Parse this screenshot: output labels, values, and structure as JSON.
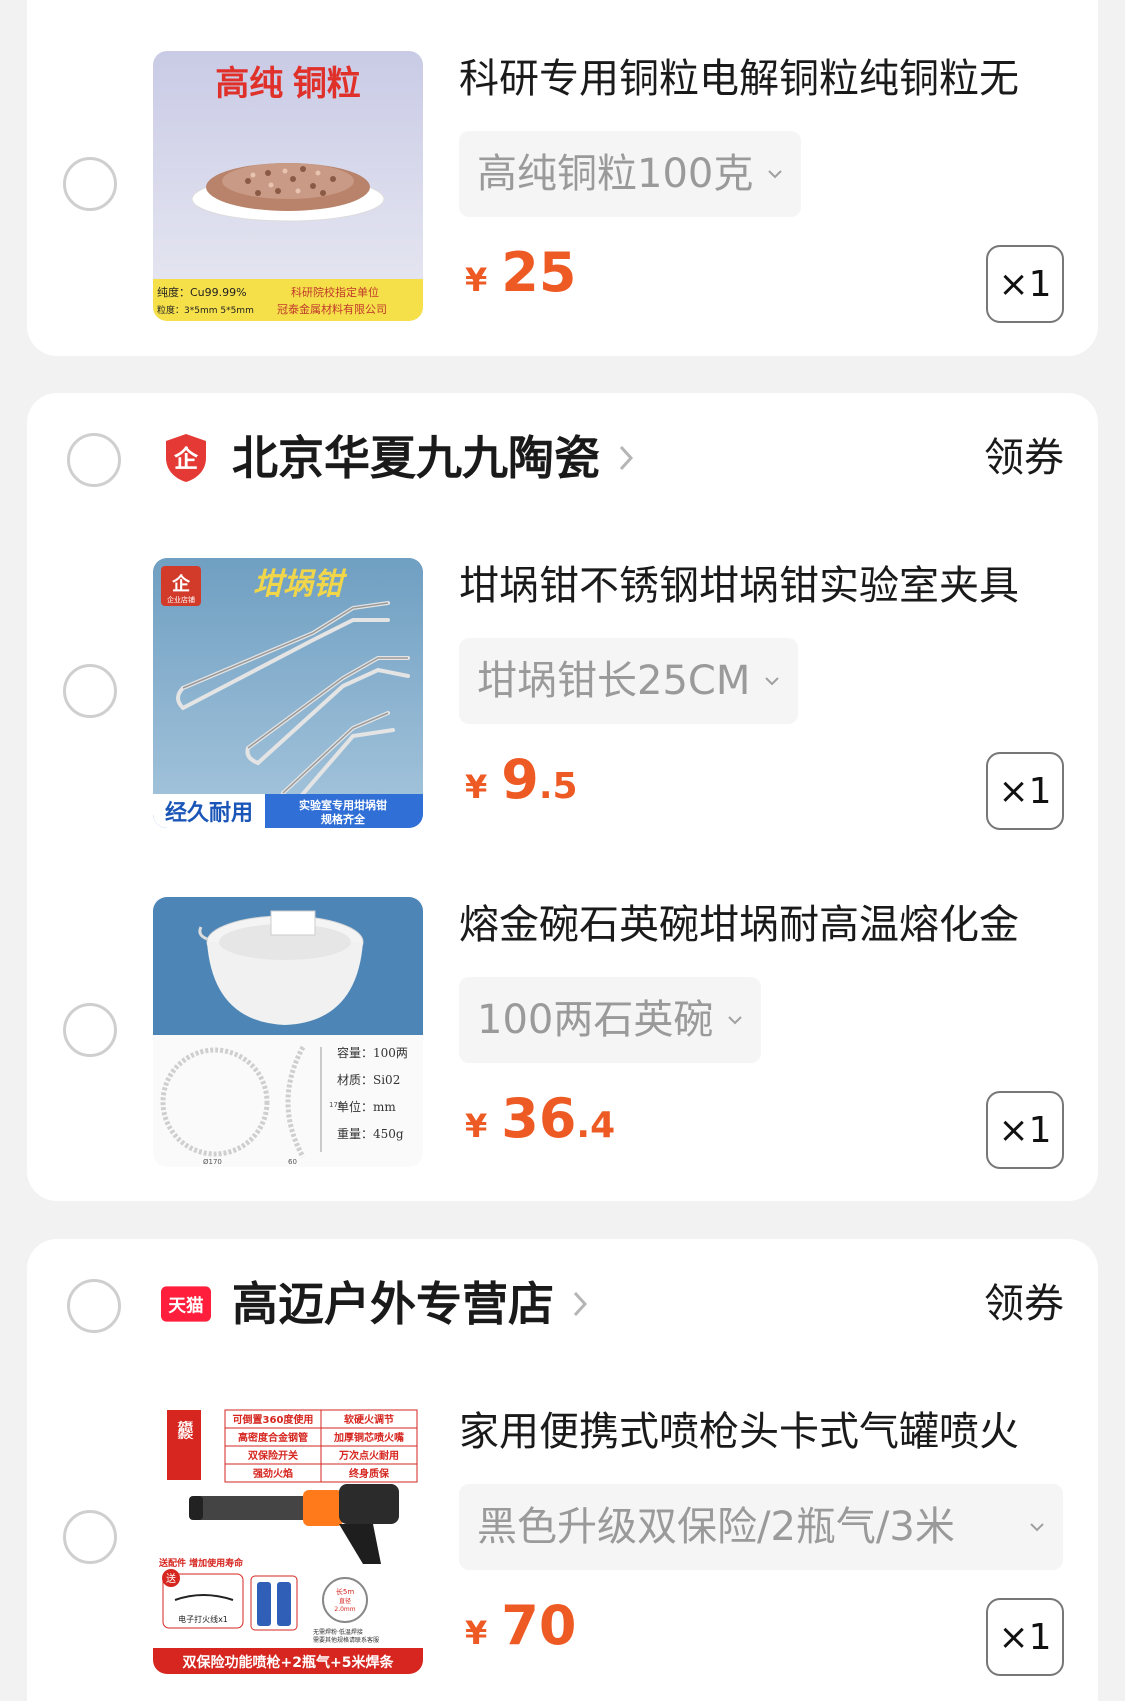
{
  "colors": {
    "accent": "#ee5a24",
    "card": "#ffffff",
    "background": "#f2f2f2"
  },
  "coupon_label": "领券",
  "currency": "¥",
  "stores": [
    {
      "items": [
        {
          "title": "科研专用铜粒电解铜粒纯铜粒无",
          "sku": "高纯铜粒100克",
          "price_int": "25",
          "price_dec": "",
          "qty": "×1",
          "thumb": {
            "heading": "高纯 铜粒",
            "line1": "纯度：Cu99.99%",
            "line2": "粒度：3*5mm 5*5mm",
            "line3": "科研院校指定单位",
            "line4": "冠泰金属材料有限公司"
          }
        }
      ]
    },
    {
      "name": "北京华夏九九陶瓷",
      "logo": "企",
      "items": [
        {
          "title": "坩埚钳不锈钢坩埚钳实验室夹具",
          "sku": "坩埚钳长25CM",
          "price_int": "9",
          "price_dec": ".5",
          "qty": "×1",
          "thumb": {
            "badge1": "企",
            "badge2": "企业店铺",
            "heading": "坩埚钳",
            "banner_left": "经久耐用",
            "banner_right1": "实验室专用坩埚钳",
            "banner_right2": "规格齐全"
          }
        },
        {
          "title": "熔金碗石英碗坩埚耐高温熔化金",
          "sku": "100两石英碗",
          "price_int": "36",
          "price_dec": ".4",
          "qty": "×1",
          "thumb": {
            "spec1": "容量：100两",
            "spec2": "材质：Si02",
            "spec3": "单位：mm",
            "spec4": "重量：450g",
            "dim1": "Ø170",
            "dim2": "60",
            "dim3": "175"
          }
        }
      ]
    },
    {
      "name": "高迈户外专营店",
      "logo": "天猫",
      "items": [
        {
          "title": "家用便携式喷枪头卡式气罐喷火",
          "sku": "黑色升级双保险/2瓶气/3米",
          "price_int": "70",
          "price_dec": "",
          "qty": "×1",
          "thumb": {
            "flag": "旗舰款",
            "f1": "可倒置360度使用",
            "f2": "软硬火调节",
            "f3": "高密度合金钢管",
            "f4": "加厚铜芯喷火嘴",
            "f5": "双保险开关",
            "f6": "万次点火耐用",
            "f7": "强劲火焰",
            "f8": "终身质保",
            "gift": "送配件 增加使用寿命",
            "send": "送",
            "igniter": "电子打火线x1",
            "wire1": "长5m",
            "wire2": "直径",
            "wire3": "2.0mm",
            "note1": "无需焊粉·低温焊接",
            "note2": "需要其他规格请联系客服",
            "banner": "双保险功能喷枪+2瓶气+5米焊条"
          }
        }
      ]
    }
  ]
}
